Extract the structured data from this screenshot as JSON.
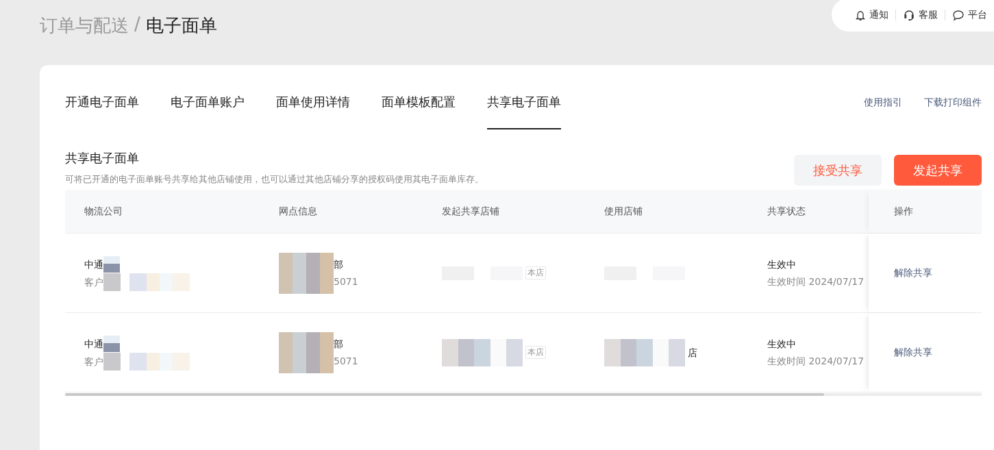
{
  "header": {
    "breadcrumb_parent": "订单与配送",
    "separator": "/",
    "breadcrumb_current": "电子面单",
    "top_links": [
      {
        "kind": "bell",
        "label": "通知"
      },
      {
        "kind": "headset",
        "label": "客服"
      },
      {
        "kind": "chat",
        "label": "平台"
      }
    ]
  },
  "tabs": [
    {
      "label": "开通电子面单",
      "selected": false
    },
    {
      "label": "电子面单账户",
      "selected": false
    },
    {
      "label": "面单使用详情",
      "selected": false
    },
    {
      "label": "面单模板配置",
      "selected": false
    },
    {
      "label": "共享电子面单",
      "selected": true
    }
  ],
  "tab_links": [
    "使用指引",
    "下载打印组件"
  ],
  "section": {
    "title": "共享电子面单",
    "description": "可将已开通的电子面单账号共享给其他店铺使用，也可以通过其他店铺分享的授权码使用其电子面单库存。"
  },
  "buttons": [
    {
      "kind": "secondary",
      "label": "接受共享"
    },
    {
      "kind": "primary",
      "label": "发起共享"
    }
  ],
  "table": {
    "columns": [
      "物流公司",
      "网点信息",
      "发起共享店铺",
      "使用店铺",
      "共享状态",
      "操作"
    ],
    "rows": [
      {
        "company": "中通",
        "account": "客户",
        "branch": "部",
        "branch_code": "5071",
        "initiator_tag": "本店",
        "user_shop": "",
        "status": "生效中",
        "effective_time": "生效时间 2024/07/17",
        "action": "解除共享"
      },
      {
        "company": "中通",
        "account": "客户",
        "branch": "部",
        "branch_code": "5071",
        "initiator_tag": "本店",
        "user_shop": "店",
        "status": "生效中",
        "effective_time": "生效时间 2024/07/17",
        "action": "解除共享"
      }
    ]
  }
}
